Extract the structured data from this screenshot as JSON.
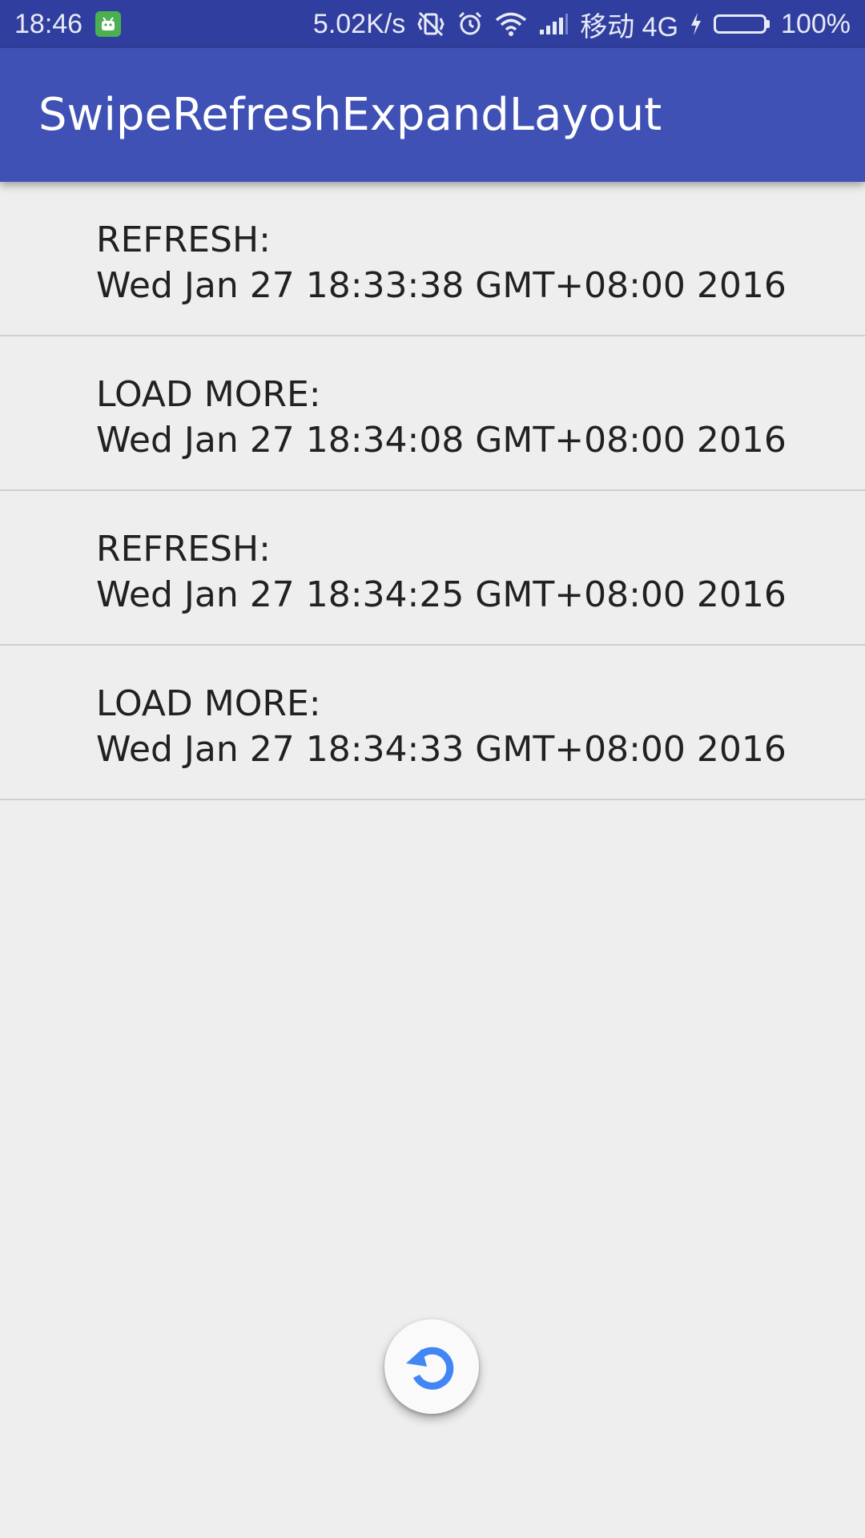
{
  "status_bar": {
    "time": "18:46",
    "network_speed": "5.02K/s",
    "carrier": "移动 4G",
    "battery_percent": "100%",
    "battery_level": 1.0,
    "icons": [
      "android-notification-icon",
      "vibrate-off-icon",
      "alarm-icon",
      "wifi-icon",
      "signal-icon",
      "charging-icon",
      "battery-icon"
    ]
  },
  "app_bar": {
    "title": "SwipeRefreshExpandLayout",
    "color": "#3f51b5"
  },
  "list": {
    "items": [
      {
        "label": "REFRESH:",
        "time": "Wed Jan 27 18:33:38 GMT+08:00 2016"
      },
      {
        "label": "LOAD MORE:",
        "time": "Wed Jan 27 18:34:08 GMT+08:00 2016"
      },
      {
        "label": "REFRESH:",
        "time": "Wed Jan 27 18:34:25 GMT+08:00 2016"
      },
      {
        "label": "LOAD MORE:",
        "time": "Wed Jan 27 18:34:33 GMT+08:00 2016"
      }
    ]
  },
  "refresh_indicator": {
    "icon": "refresh-icon",
    "accent_color": "#4285f4"
  }
}
